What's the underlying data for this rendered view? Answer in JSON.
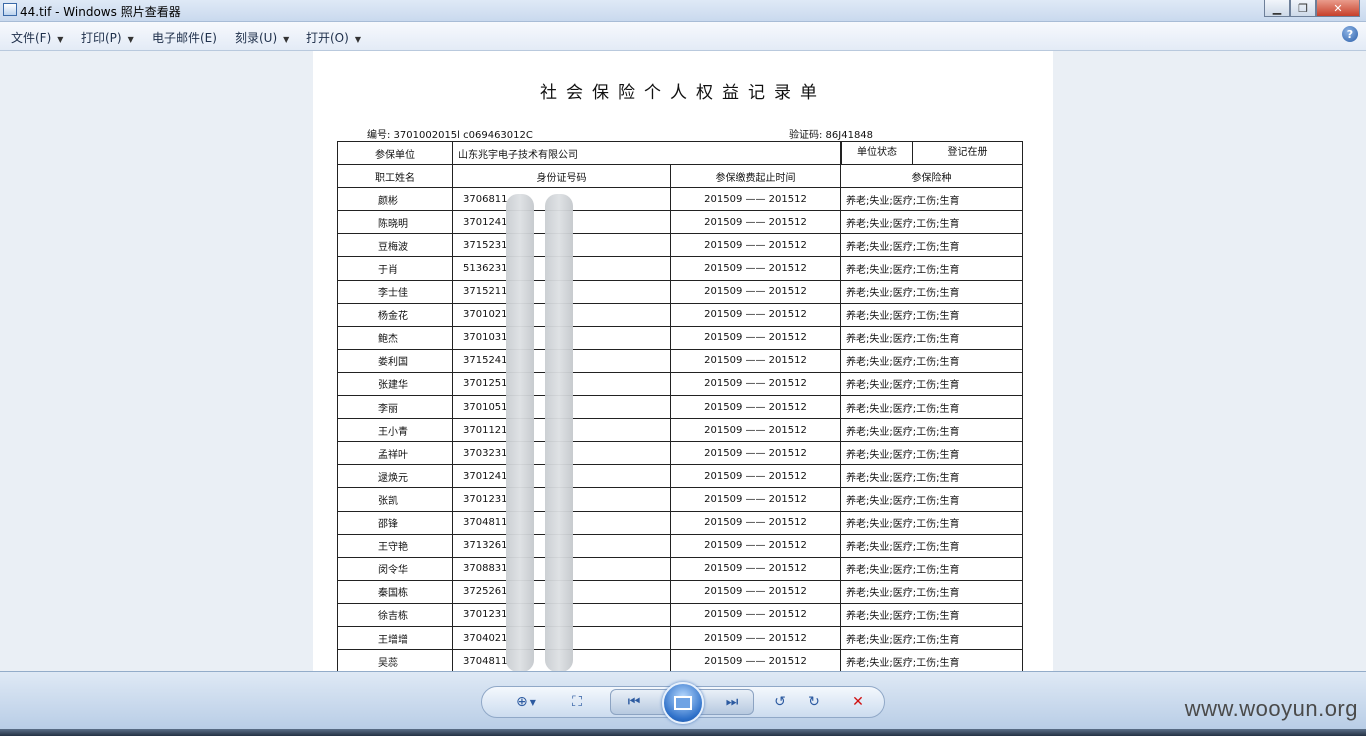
{
  "window": {
    "title": "44.tif - Windows 照片查看器"
  },
  "menu": {
    "file": "文件(F)",
    "print": "打印(P)",
    "email": "电子邮件(E)",
    "burn": "刻录(U)",
    "open": "打开(O)"
  },
  "document": {
    "title": "社会保险个人权益记录单",
    "number": "编号: 3701002015l c069463012C",
    "verify_code": "验证码: 86J41848",
    "unit_label": "参保单位",
    "unit_value": "山东兆宇电子技术有限公司",
    "status_label": "单位状态",
    "status_value": "登记在册",
    "headers": [
      "职工姓名",
      "身份证号码",
      "参保缴费起止时间",
      "参保险种"
    ],
    "rows": [
      {
        "name": "颜彬",
        "id": "3706811",
        "period": "201509 —— 201512",
        "types": "养老;失业;医疗;工伤;生育"
      },
      {
        "name": "陈晓明",
        "id": "3701241",
        "period": "201509 —— 201512",
        "types": "养老;失业;医疗;工伤;生育"
      },
      {
        "name": "豆梅波",
        "id": "3715231",
        "period": "201509 —— 201512",
        "types": "养老;失业;医疗;工伤;生育"
      },
      {
        "name": "于肖",
        "id": "5136231",
        "period": "201509 —— 201512",
        "types": "养老;失业;医疗;工伤;生育"
      },
      {
        "name": "李士佳",
        "id": "3715211",
        "period": "201509 —— 201512",
        "types": "养老;失业;医疗;工伤;生育"
      },
      {
        "name": "杨金花",
        "id": "3701021",
        "period": "201509 —— 201512",
        "types": "养老;失业;医疗;工伤;生育"
      },
      {
        "name": "鲍杰",
        "id": "3701031",
        "period": "201509 —— 201512",
        "types": "养老;失业;医疗;工伤;生育"
      },
      {
        "name": "娄利国",
        "id": "3715241",
        "period": "201509 —— 201512",
        "types": "养老;失业;医疗;工伤;生育"
      },
      {
        "name": "张建华",
        "id": "3701251",
        "period": "201509 —— 201512",
        "types": "养老;失业;医疗;工伤;生育"
      },
      {
        "name": "李丽",
        "id": "3701051",
        "period": "201509 —— 201512",
        "types": "养老;失业;医疗;工伤;生育"
      },
      {
        "name": "王小青",
        "id": "3701121",
        "period": "201509 —— 201512",
        "types": "养老;失业;医疗;工伤;生育"
      },
      {
        "name": "孟祥叶",
        "id": "3703231",
        "period": "201509 —— 201512",
        "types": "养老;失业;医疗;工伤;生育"
      },
      {
        "name": "逯焕元",
        "id": "3701241",
        "period": "201509 —— 201512",
        "types": "养老;失业;医疗;工伤;生育"
      },
      {
        "name": "张凯",
        "id": "3701231",
        "period": "201509 —— 201512",
        "types": "养老;失业;医疗;工伤;生育"
      },
      {
        "name": "邵锋",
        "id": "3704811",
        "period": "201509 —— 201512",
        "types": "养老;失业;医疗;工伤;生育"
      },
      {
        "name": "王守艳",
        "id": "3713261",
        "period": "201509 —— 201512",
        "types": "养老;失业;医疗;工伤;生育"
      },
      {
        "name": "闵令华",
        "id": "3708831",
        "period": "201509 —— 201512",
        "types": "养老;失业;医疗;工伤;生育"
      },
      {
        "name": "秦国栋",
        "id": "3725261",
        "period": "201509 —— 201512",
        "types": "养老;失业;医疗;工伤;生育"
      },
      {
        "name": "徐吉栋",
        "id": "3701231",
        "period": "201509 —— 201512",
        "types": "养老;失业;医疗;工伤;生育"
      },
      {
        "name": "王增增",
        "id": "3704021",
        "period": "201509 —— 201512",
        "types": "养老;失业;医疗;工伤;生育"
      },
      {
        "name": "吴蕊",
        "id": "3704811",
        "period": "201509 —— 201512",
        "types": "养老;失业;医疗;工伤;生育"
      }
    ]
  },
  "watermark": "www.wooyun.org",
  "icons": {
    "zoom": "zoom-icon",
    "fit": "actual-size-icon",
    "prev": "previous-icon",
    "slideshow": "slideshow-icon",
    "next": "next-icon",
    "rotate_ccw": "rotate-left-icon",
    "rotate_cw": "rotate-right-icon",
    "delete": "delete-icon"
  }
}
